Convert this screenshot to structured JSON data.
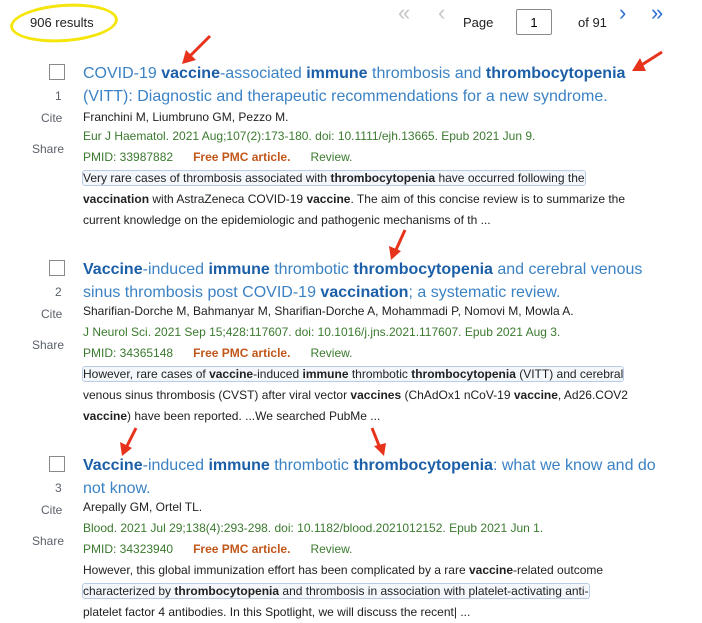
{
  "results": {
    "count_label": "906 results"
  },
  "pager": {
    "first_icon": "double-chevron-left-icon",
    "prev_icon": "chevron-left-icon",
    "next_icon": "chevron-right-icon",
    "last_icon": "double-chevron-right-icon",
    "page_label": "Page",
    "page_value": "1",
    "of_label": "of 91"
  },
  "labels": {
    "cite": "Cite",
    "share": "Share"
  },
  "items": [
    {
      "number": "1",
      "title_segments": [
        {
          "t": "COVID-19 ",
          "b": false
        },
        {
          "t": "vaccine",
          "b": true
        },
        {
          "t": "-associated ",
          "b": false
        },
        {
          "t": "immune",
          "b": true
        },
        {
          "t": " thrombosis and ",
          "b": false
        },
        {
          "t": "thrombocytopenia",
          "b": true
        },
        {
          "t": " (VITT): Diagnostic and therapeutic recommendations for a new syndrome.",
          "b": false
        }
      ],
      "authors": "Franchini M, Liumbruno GM, Pezzo M.",
      "citation": "Eur J Haematol. 2021 Aug;107(2):173-180. doi: 10.1111/ejh.13665. Epub 2021 Jun 9.",
      "pmid": "PMID: 33987882",
      "free_pmc": "Free PMC article.",
      "review": "Review.",
      "snippet_lines": [
        {
          "boxed": true,
          "segs": [
            {
              "t": "Very rare cases of thrombosis associated with ",
              "b": false
            },
            {
              "t": "thrombocytopenia",
              "b": true
            },
            {
              "t": " have occurred following the",
              "b": false
            }
          ]
        },
        {
          "boxed": false,
          "segs": [
            {
              "t": "vaccination",
              "b": true
            },
            {
              "t": " with AstraZeneca COVID-19 ",
              "b": false
            },
            {
              "t": "vaccine",
              "b": true
            },
            {
              "t": ". The aim of this concise review is to summarize the",
              "b": false
            }
          ]
        },
        {
          "boxed": false,
          "segs": [
            {
              "t": "current knowledge on the epidemiologic and pathogenic mechanisms of th ...",
              "b": false
            }
          ]
        }
      ]
    },
    {
      "number": "2",
      "title_segments": [
        {
          "t": "Vaccine",
          "b": true
        },
        {
          "t": "-induced ",
          "b": false
        },
        {
          "t": "immune",
          "b": true
        },
        {
          "t": " thrombotic ",
          "b": false
        },
        {
          "t": "thrombocytopenia",
          "b": true
        },
        {
          "t": " and cerebral venous sinus thrombosis post COVID-19 ",
          "b": false
        },
        {
          "t": "vaccination",
          "b": true
        },
        {
          "t": "; a systematic review.",
          "b": false
        }
      ],
      "authors": "Sharifian-Dorche M, Bahmanyar M, Sharifian-Dorche A, Mohammadi P, Nomovi M, Mowla A.",
      "citation": "J Neurol Sci. 2021 Sep 15;428:117607. doi: 10.1016/j.jns.2021.117607. Epub 2021 Aug 3.",
      "pmid": "PMID: 34365148",
      "free_pmc": "Free PMC article.",
      "review": "Review.",
      "snippet_lines": [
        {
          "boxed": true,
          "segs": [
            {
              "t": "However, rare cases of ",
              "b": false
            },
            {
              "t": "vaccine",
              "b": true
            },
            {
              "t": "-induced ",
              "b": false
            },
            {
              "t": "immune",
              "b": true
            },
            {
              "t": " thrombotic ",
              "b": false
            },
            {
              "t": "thrombocytopenia",
              "b": true
            },
            {
              "t": " (VITT) and cerebral",
              "b": false
            }
          ]
        },
        {
          "boxed": false,
          "segs": [
            {
              "t": "venous sinus thrombosis (CVST) after viral vector ",
              "b": false
            },
            {
              "t": "vaccines",
              "b": true
            },
            {
              "t": " (ChAdOx1 nCoV-19 ",
              "b": false
            },
            {
              "t": "vaccine",
              "b": true
            },
            {
              "t": ", Ad26.COV2",
              "b": false
            }
          ]
        },
        {
          "boxed": false,
          "segs": [
            {
              "t": "vaccine",
              "b": true
            },
            {
              "t": ") have been reported. ...We searched PubMe ...",
              "b": false
            }
          ]
        }
      ]
    },
    {
      "number": "3",
      "title_segments": [
        {
          "t": "Vaccine",
          "b": true
        },
        {
          "t": "-induced ",
          "b": false
        },
        {
          "t": "immune",
          "b": true
        },
        {
          "t": " thrombotic ",
          "b": false
        },
        {
          "t": "thrombocytopenia",
          "b": true
        },
        {
          "t": ": what we know and do not know.",
          "b": false
        }
      ],
      "authors": "Arepally GM, Ortel TL.",
      "citation": "Blood. 2021 Jul 29;138(4):293-298. doi: 10.1182/blood.2021012152. Epub 2021 Jun 1.",
      "pmid": "PMID: 34323940",
      "free_pmc": "Free PMC article.",
      "review": "Review.",
      "snippet_lines": [
        {
          "boxed": false,
          "segs": [
            {
              "t": "However, this global immunization effort has been complicated by a rare ",
              "b": false
            },
            {
              "t": "vaccine",
              "b": true
            },
            {
              "t": "-related outcome",
              "b": false
            }
          ]
        },
        {
          "boxed": true,
          "segs": [
            {
              "t": "characterized by ",
              "b": false
            },
            {
              "t": "thrombocytopenia",
              "b": true
            },
            {
              "t": " and thrombosis in association with platelet-activating anti-",
              "b": false
            }
          ]
        },
        {
          "boxed": false,
          "segs": [
            {
              "t": "platelet factor 4 antibodies. In this Spotlight, we will discuss the recent| ...",
              "b": false
            }
          ]
        }
      ]
    }
  ],
  "colors": {
    "annotation_arrow": "#e8331c",
    "annotation_circle": "#f5e50a",
    "title_link": "#3b82c4"
  },
  "annotations": {
    "arrow_icon": "red-arrow-icon",
    "circle": "yellow-circle-annotation"
  }
}
